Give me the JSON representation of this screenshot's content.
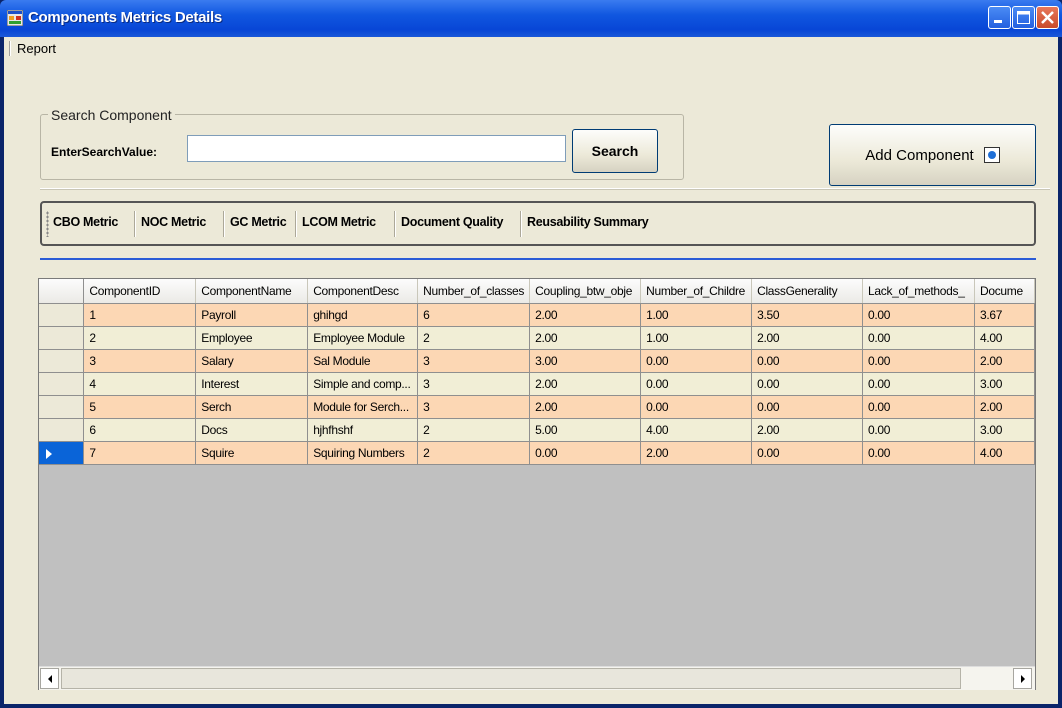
{
  "window": {
    "title": "Components Metrics Details"
  },
  "menu": {
    "items": [
      {
        "label": "Report"
      }
    ]
  },
  "search": {
    "group_title": "Search Component",
    "label": "EnterSearchValue:",
    "value": "",
    "button_label": "Search"
  },
  "add_button": {
    "label": "Add Component"
  },
  "toolbar": {
    "items": [
      {
        "label": "CBO Metric"
      },
      {
        "label": "NOC Metric"
      },
      {
        "label": "GC Metric"
      },
      {
        "label": "LCOM Metric"
      },
      {
        "label": "Document Quality"
      },
      {
        "label": "Reusability Summary"
      }
    ]
  },
  "grid": {
    "columns": [
      "ComponentID",
      "ComponentName",
      "ComponentDesc",
      "Number_of_classes",
      "Coupling_btw_obje",
      "Number_of_Childre",
      "ClassGenerality",
      "Lack_of_methods_",
      "Docume"
    ],
    "rows": [
      [
        "1",
        "Payroll",
        "ghihgd",
        "6",
        "2.00",
        "1.00",
        "3.50",
        "0.00",
        "3.67"
      ],
      [
        "2",
        "Employee",
        "Employee Module",
        "2",
        "2.00",
        "1.00",
        "2.00",
        "0.00",
        "4.00"
      ],
      [
        "3",
        "Salary",
        "Sal Module",
        "3",
        "3.00",
        "0.00",
        "0.00",
        "0.00",
        "2.00"
      ],
      [
        "4",
        "Interest",
        "Simple and comp...",
        "3",
        "2.00",
        "0.00",
        "0.00",
        "0.00",
        "3.00"
      ],
      [
        "5",
        "Serch",
        "Module for Serch...",
        "3",
        "2.00",
        "0.00",
        "0.00",
        "0.00",
        "2.00"
      ],
      [
        "6",
        "Docs",
        "hjhfhshf",
        "2",
        "5.00",
        "4.00",
        "2.00",
        "0.00",
        "3.00"
      ],
      [
        "7",
        "Squire",
        "Squiring Numbers",
        "2",
        "0.00",
        "2.00",
        "0.00",
        "0.00",
        "4.00"
      ]
    ],
    "current_row": 6
  }
}
